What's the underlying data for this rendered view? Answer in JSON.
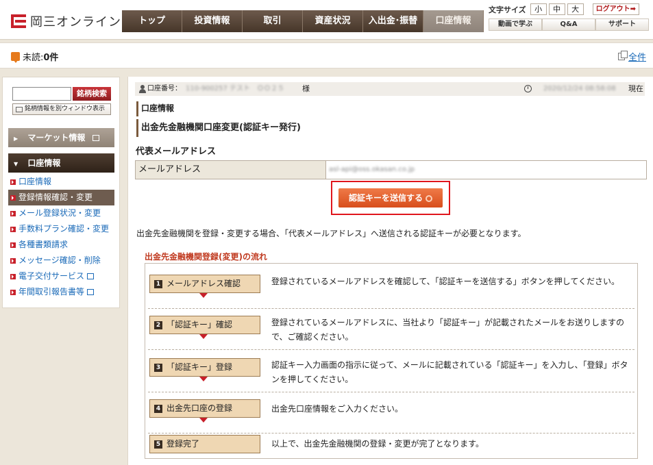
{
  "brand": {
    "name": "岡三オンライン"
  },
  "nav": {
    "items": [
      {
        "label": "トップ"
      },
      {
        "label": "投資情報"
      },
      {
        "label": "取引"
      },
      {
        "label": "資産状況"
      },
      {
        "label": "入出金･振替"
      },
      {
        "label": "口座情報",
        "active": true
      }
    ]
  },
  "util": {
    "font_size_label": "文字サイズ",
    "font_sizes": [
      "小",
      "中",
      "大"
    ],
    "logout_label": "ログアウト➡",
    "sub_links": [
      "動画で学ぶ",
      "Q&A",
      "サポート"
    ]
  },
  "alert": {
    "unread_prefix": "未読:",
    "unread_count": "0件",
    "all_link": "全件"
  },
  "sidebar": {
    "search_button": "銘柄検索",
    "new_window_button": "銘柄情報を別ウィンドウ表示",
    "market_header": "マーケット情報",
    "account_header": "口座情報",
    "items": [
      {
        "label": "口座情報",
        "active": false
      },
      {
        "label": "登録情報確認・変更",
        "active": true
      },
      {
        "label": "メール登録状況・変更",
        "active": false
      },
      {
        "label": "手数料プラン確認・変更",
        "active": false
      },
      {
        "label": "各種書類請求",
        "active": false
      },
      {
        "label": "メッセージ確認・削除",
        "active": false
      },
      {
        "label": "電子交付サービス",
        "active": false,
        "window_icon": true
      },
      {
        "label": "年間取引報告書等",
        "active": false,
        "window_icon": true
      }
    ]
  },
  "account_bar": {
    "account_label": "口座番号：",
    "account_value": "110-900257 テスト　ＯＯ２５",
    "suffix": "様",
    "datetime": "2020/12/24 08:58:08",
    "now_label": "現在"
  },
  "page": {
    "breadcrumb": "口座情報",
    "title": "出金先金融機関口座変更(認証キー発行)",
    "section_heading": "代表メールアドレス",
    "mail_label": "メールアドレス",
    "mail_value": "asl-api@oss.okasan.co.jp",
    "send_button": "認証キーを送信する",
    "description": "出金先金融機関を登録・変更する場合、「代表メールアドレス」へ送信される認証キーが必要となります。",
    "flow_title": "出金先金融機関登録(変更)の流れ"
  },
  "steps": [
    {
      "num": "1",
      "label": "メールアドレス確認",
      "text": "登録されているメールアドレスを確認して、「認証キーを送信する」ボタンを押してください。"
    },
    {
      "num": "2",
      "label": "「認証キー」確認",
      "text": "登録されているメールアドレスに、当社より「認証キー」が記載されたメールをお送りしますので、ご確認ください。"
    },
    {
      "num": "3",
      "label": "「認証キー」登録",
      "text": "認証キー入力画面の指示に従って、メールに記載されている「認証キー」を入力し、「登録」ボタンを押してください。"
    },
    {
      "num": "4",
      "label": "出金先口座の登録",
      "text": "出金先口座情報をご入力ください。"
    },
    {
      "num": "5",
      "label": "登録完了",
      "text": "以上で、出金先金融機関の登録・変更が完了となります。"
    }
  ]
}
